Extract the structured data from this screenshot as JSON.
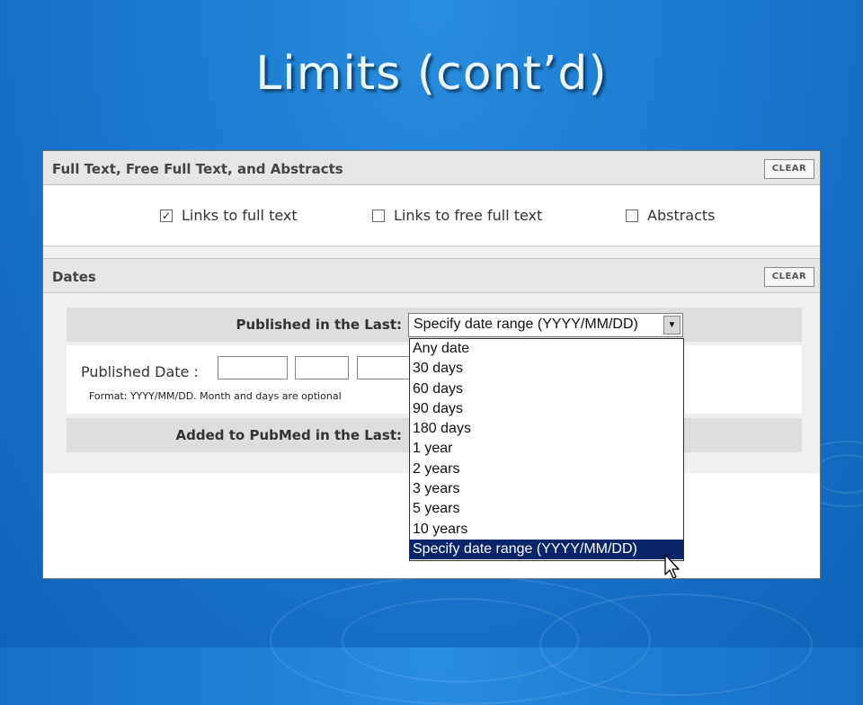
{
  "slide": {
    "title": "Limits (cont’d)"
  },
  "full_text_section": {
    "heading": "Full Text, Free Full Text, and Abstracts",
    "clear_label": "CLEAR",
    "options": [
      {
        "label": "Links to full text",
        "checked": true
      },
      {
        "label": "Links to free full text",
        "checked": false
      },
      {
        "label": "Abstracts",
        "checked": false
      }
    ]
  },
  "dates_section": {
    "heading": "Dates",
    "clear_label": "CLEAR",
    "published_last_label": "Published in the Last:",
    "published_last_selected": "Specify date range (YYYY/MM/DD)",
    "published_date_label": "Published Date :",
    "format_hint": "Format: YYYY/MM/DD. Month and days are optional",
    "added_label": "Added to PubMed in the Last:",
    "dropdown_options": [
      "Any date",
      "30 days",
      "60 days",
      "90 days",
      "180 days",
      "1 year",
      "2 years",
      "3 years",
      "5 years",
      "10 years",
      "Specify date range (YYYY/MM/DD)"
    ],
    "dropdown_highlighted_index": 10
  },
  "icons": {
    "check": "check-icon",
    "dropdown_arrow": "chevron-down-icon",
    "cursor": "mouse-pointer-icon"
  }
}
